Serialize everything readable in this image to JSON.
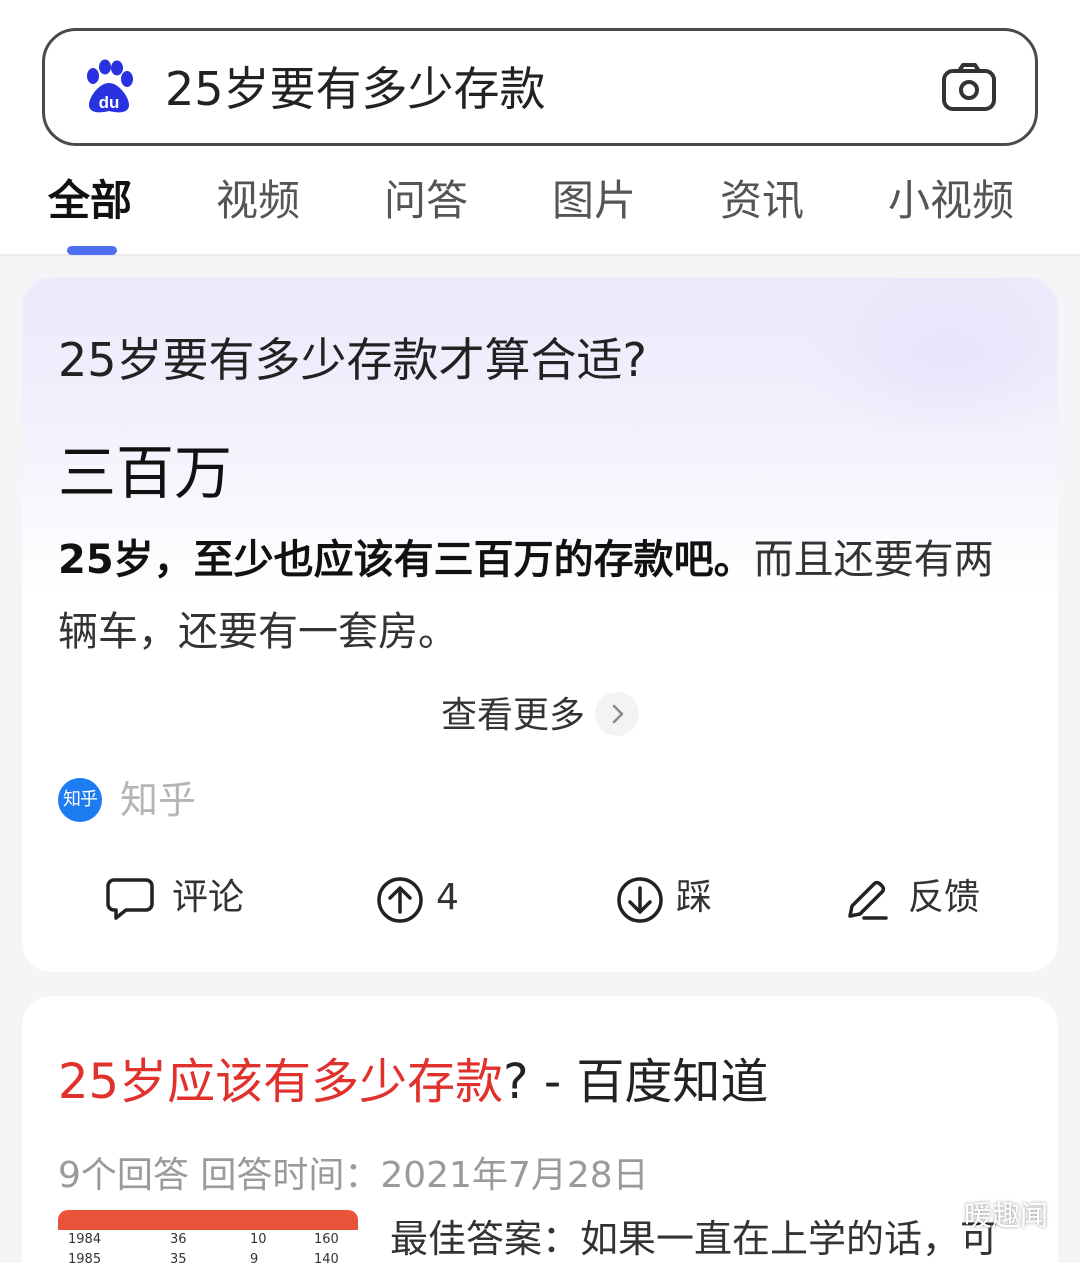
{
  "search": {
    "query": "25岁要有多少存款"
  },
  "tabs": [
    {
      "label": "全部",
      "active": true
    },
    {
      "label": "视频",
      "active": false
    },
    {
      "label": "问答",
      "active": false
    },
    {
      "label": "图片",
      "active": false
    },
    {
      "label": "资讯",
      "active": false
    },
    {
      "label": "小视频",
      "active": false
    }
  ],
  "answer_card": {
    "question": "25岁要有多少存款才算合适?",
    "answer": "三百万",
    "text_bold": "25岁，至少也应该有三百万的存款吧。",
    "text_rest": "而且还要有两辆车，还要有一套房。",
    "more_label": "查看更多",
    "source_badge": "知乎",
    "source_name": "知乎",
    "actions": {
      "comment": "评论",
      "upvote_count": "4",
      "downvote": "踩",
      "feedback": "反馈"
    }
  },
  "result_card": {
    "title_highlight": "25岁应该有多少存款",
    "title_rest": "? - 百度知道",
    "meta": "9个回答  回答时间：2021年7月28日",
    "snippet": "最佳答案：如果一直在上学的话，可",
    "thumb_rows": [
      [
        "1984",
        "36",
        "10",
        "160"
      ],
      [
        "1985",
        "35",
        "9",
        "140"
      ]
    ]
  },
  "watermark": "暖趣闻",
  "colors": {
    "accent": "#4e6ef2",
    "highlight": "#e1312c",
    "logo": "#2932e1"
  }
}
